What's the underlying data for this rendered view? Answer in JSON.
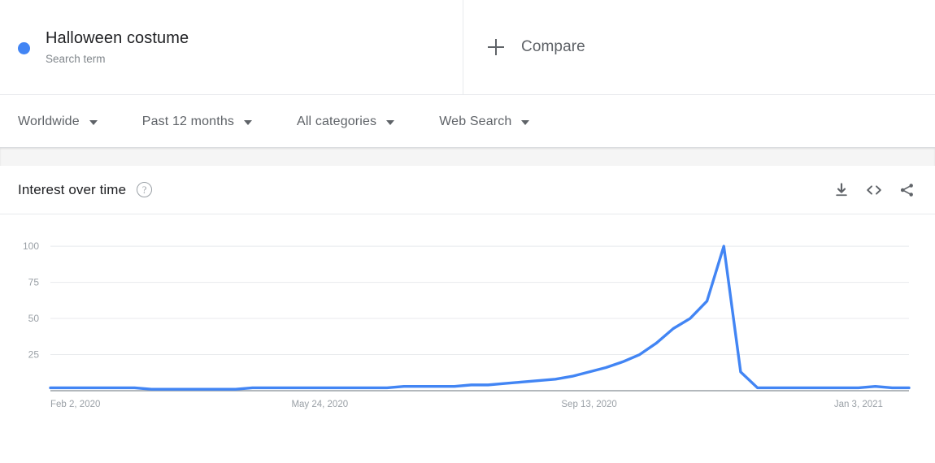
{
  "term": {
    "title": "Halloween costume",
    "subtitle": "Search term",
    "dot_color": "#4285f4"
  },
  "compare": {
    "label": "Compare",
    "icon": "plus-icon"
  },
  "filters": [
    {
      "label": "Worldwide",
      "icon": "chevron-down-icon"
    },
    {
      "label": "Past 12 months",
      "icon": "chevron-down-icon"
    },
    {
      "label": "All categories",
      "icon": "chevron-down-icon"
    },
    {
      "label": "Web Search",
      "icon": "chevron-down-icon"
    }
  ],
  "card": {
    "title": "Interest over time",
    "help_icon": "help-icon",
    "help_glyph": "?",
    "actions": [
      {
        "name": "download-icon",
        "tooltip": "Download"
      },
      {
        "name": "embed-code-icon",
        "tooltip": "Embed"
      },
      {
        "name": "share-icon",
        "tooltip": "Share"
      }
    ]
  },
  "chart_data": {
    "type": "line",
    "title": "Interest over time",
    "xlabel": "",
    "ylabel": "",
    "series_name": "Halloween costume",
    "color": "#4285f4",
    "ylim": [
      0,
      104
    ],
    "yticks": [
      25,
      50,
      75,
      100
    ],
    "ytick_labels": [
      "25",
      "50",
      "75",
      "100"
    ],
    "grid": true,
    "legend": "none",
    "xtick_labels": [
      "Feb 2, 2020",
      "May 24, 2020",
      "Sep 13, 2020",
      "Jan 3, 2021"
    ],
    "xtick_indices": [
      0,
      16,
      32,
      48
    ],
    "x": [
      "Feb 2, 2020",
      "Feb 9, 2020",
      "Feb 16, 2020",
      "Feb 23, 2020",
      "Mar 1, 2020",
      "Mar 8, 2020",
      "Mar 15, 2020",
      "Mar 22, 2020",
      "Mar 29, 2020",
      "Apr 5, 2020",
      "Apr 12, 2020",
      "Apr 19, 2020",
      "Apr 26, 2020",
      "May 3, 2020",
      "May 10, 2020",
      "May 17, 2020",
      "May 24, 2020",
      "May 31, 2020",
      "Jun 7, 2020",
      "Jun 14, 2020",
      "Jun 21, 2020",
      "Jun 28, 2020",
      "Jul 5, 2020",
      "Jul 12, 2020",
      "Jul 19, 2020",
      "Jul 26, 2020",
      "Aug 2, 2020",
      "Aug 9, 2020",
      "Aug 16, 2020",
      "Aug 23, 2020",
      "Aug 30, 2020",
      "Sep 6, 2020",
      "Sep 13, 2020",
      "Sep 20, 2020",
      "Sep 27, 2020",
      "Oct 4, 2020",
      "Oct 11, 2020",
      "Oct 18, 2020",
      "Oct 25, 2020",
      "Nov 1, 2020",
      "Nov 8, 2020",
      "Nov 15, 2020",
      "Nov 22, 2020",
      "Nov 29, 2020",
      "Dec 6, 2020",
      "Dec 13, 2020",
      "Dec 20, 2020",
      "Dec 27, 2020",
      "Jan 3, 2021",
      "Jan 10, 2021",
      "Jan 17, 2021",
      "Jan 24, 2021"
    ],
    "values": [
      2,
      2,
      2,
      2,
      2,
      2,
      1,
      1,
      1,
      1,
      1,
      1,
      2,
      2,
      2,
      2,
      2,
      2,
      2,
      2,
      2,
      3,
      3,
      3,
      3,
      4,
      4,
      5,
      6,
      7,
      8,
      10,
      13,
      16,
      20,
      25,
      33,
      43,
      50,
      62,
      100,
      13,
      2,
      2,
      2,
      2,
      2,
      2,
      2,
      3,
      2,
      2
    ],
    "peak": {
      "label": "Nov 8, 2020",
      "value": 100
    }
  }
}
